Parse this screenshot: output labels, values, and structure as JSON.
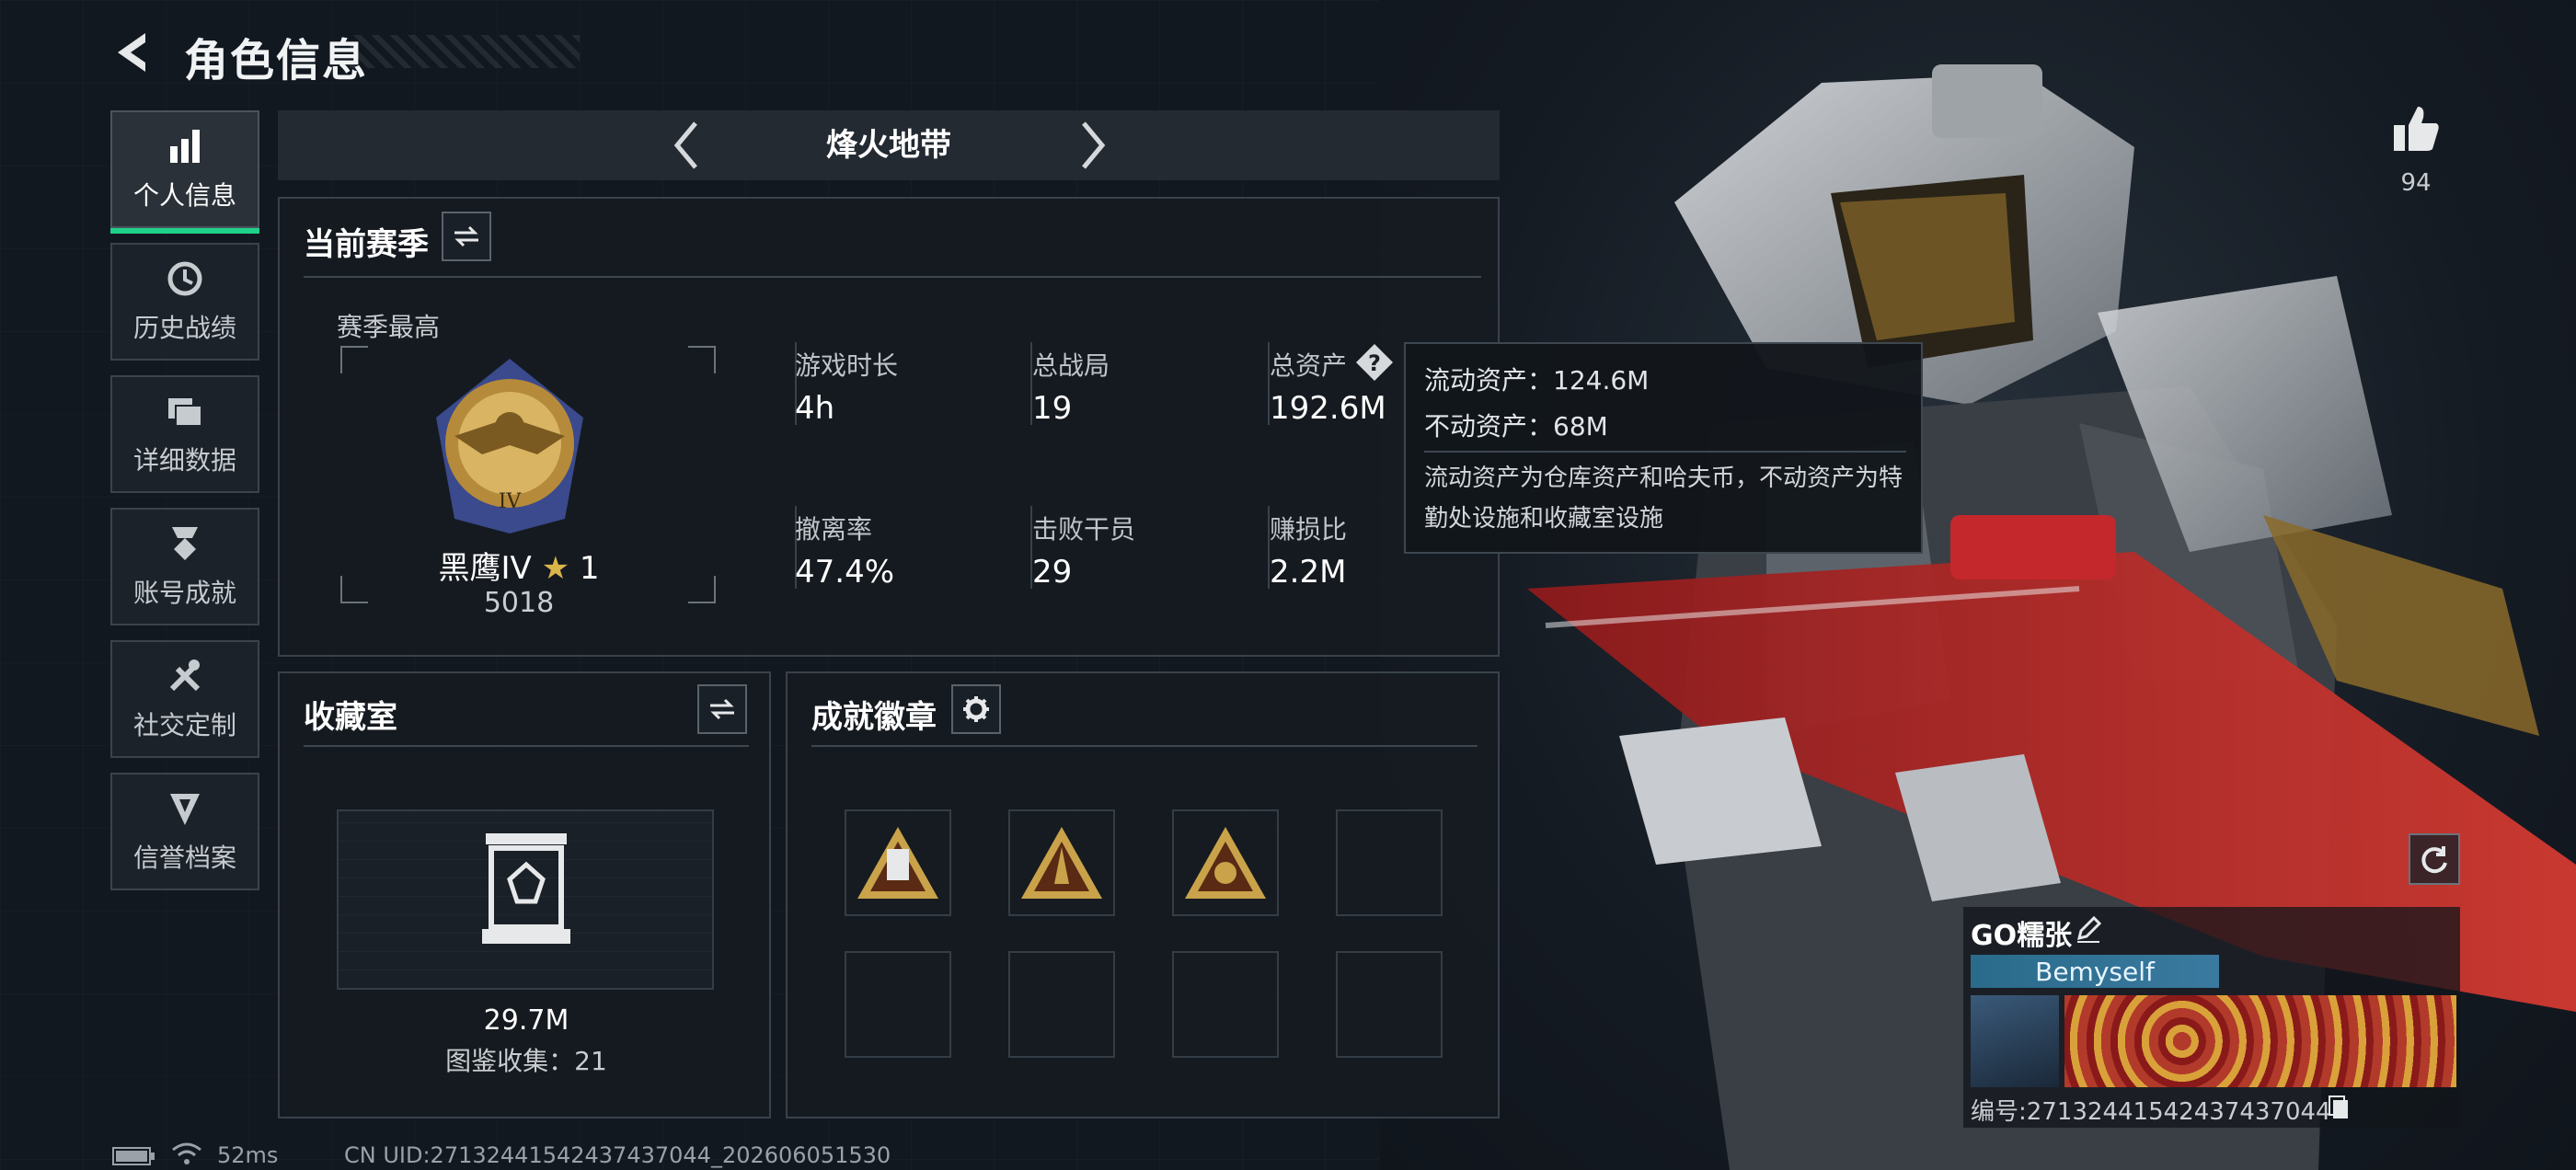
{
  "header": {
    "title": "角色信息"
  },
  "sidebar": {
    "items": [
      {
        "label": "个人信息",
        "icon": "bar-chart-icon",
        "active": true
      },
      {
        "label": "历史战绩",
        "icon": "history-clock-icon"
      },
      {
        "label": "详细数据",
        "icon": "folder-stack-icon"
      },
      {
        "label": "账号成就",
        "icon": "medal-icon"
      },
      {
        "label": "社交定制",
        "icon": "tools-icon"
      },
      {
        "label": "信誉档案",
        "icon": "shield-badge-icon"
      }
    ]
  },
  "mode": {
    "title": "烽火地带"
  },
  "season": {
    "title": "当前赛季",
    "best_label": "赛季最高",
    "rank_name": "黑鹰IV",
    "rank_stars": "1",
    "rank_points": "5018",
    "stats": [
      {
        "label": "游戏时长",
        "value": "4h"
      },
      {
        "label": "总战局",
        "value": "19"
      },
      {
        "label": "总资产",
        "value": "192.6M"
      },
      {
        "label": "撤离率",
        "value": "47.4%"
      },
      {
        "label": "击败干员",
        "value": "29"
      },
      {
        "label": "赚损比",
        "value": "2.2M"
      }
    ]
  },
  "tooltip": {
    "liquid": "流动资产：124.6M",
    "fixed": "不动资产：68M",
    "note": "流动资产为仓库资产和哈夫币，不动资产为特勤处设施和收藏室设施"
  },
  "collection": {
    "title": "收藏室",
    "value": "29.7M",
    "count_text": "图鉴收集：21"
  },
  "achievements": {
    "title": "成就徽章"
  },
  "likes": {
    "count": "94"
  },
  "player_card": {
    "name": "GO糯张",
    "tag": "Bemyself",
    "id_text": "编号:2713244154243743​7044"
  },
  "footer": {
    "ping": "52ms",
    "uid": "CN UID:27132441542437437044_202606051530"
  },
  "colors": {
    "accent": "#1fd18a",
    "gold": "#c9a24a",
    "red": "#c4282c"
  }
}
